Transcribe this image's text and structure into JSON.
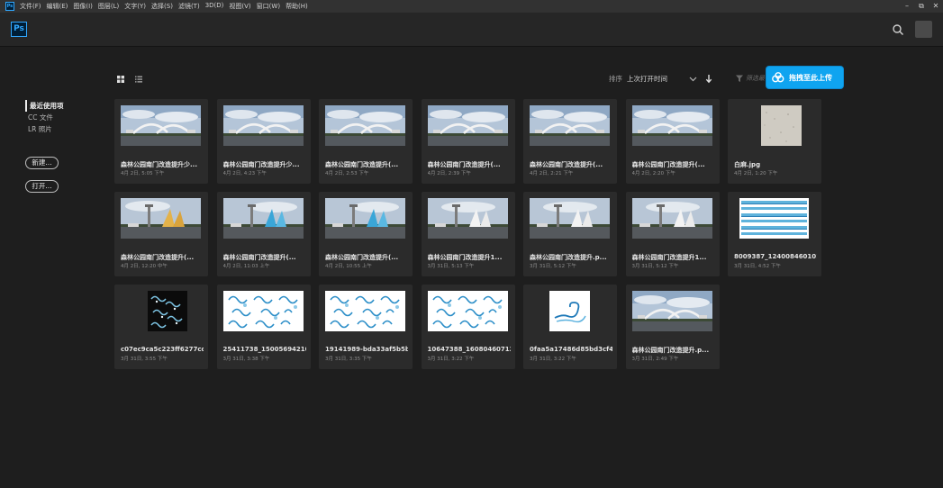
{
  "menubar": {
    "app_icon_text": "Ps",
    "items": [
      "文件(F)",
      "编辑(E)",
      "图像(I)",
      "图层(L)",
      "文字(Y)",
      "选择(S)",
      "滤镜(T)",
      "3D(D)",
      "视图(V)",
      "窗口(W)",
      "帮助(H)"
    ],
    "window_controls": [
      "–",
      "⧉",
      "✕"
    ]
  },
  "appbar": {
    "logo_text": "Ps",
    "search_icon": "search-icon"
  },
  "sidebar": {
    "nav": [
      "最近使用项",
      "CC 文件",
      "LR 照片"
    ],
    "new_label": "新建...",
    "open_label": "打开..."
  },
  "toolbar": {
    "sort_label": "排序",
    "sort_value": "上次打开时间",
    "filter_placeholder": "筛选最",
    "upload_label": "拖拽至此上传"
  },
  "colors": {
    "accent": "#31a8ff",
    "upload_badge": "#0fa4f0",
    "card_bg": "#2b2b2b",
    "page_bg": "#1e1e1e"
  },
  "recent_files": [
    {
      "name": "森林公园南门改造提升少...",
      "date": "4月 2日, 5:05 下午",
      "thumb": "bridge"
    },
    {
      "name": "森林公园南门改造提升少...",
      "date": "4月 2日, 4:23 下午",
      "thumb": "bridge"
    },
    {
      "name": "森林公园南门改造提升(...",
      "date": "4月 2日, 2:53 下午",
      "thumb": "bridge"
    },
    {
      "name": "森林公园南门改造提升(...",
      "date": "4月 2日, 2:39 下午",
      "thumb": "bridge"
    },
    {
      "name": "森林公园南门改造提升(...",
      "date": "4月 2日, 2:21 下午",
      "thumb": "bridge"
    },
    {
      "name": "森林公园南门改造提升(...",
      "date": "4月 2日, 2:20 下午",
      "thumb": "bridge"
    },
    {
      "name": "白麻.jpg",
      "date": "4月 2日, 1:20 下午",
      "thumb": "granite"
    },
    {
      "name": "森林公园南门改造提升(...",
      "date": "4月 2日, 12:20 中午",
      "thumb": "tower_gold"
    },
    {
      "name": "森林公园南门改造提升(...",
      "date": "4月 2日, 11:03 上午",
      "thumb": "tower_blue"
    },
    {
      "name": "森林公园南门改造提升(...",
      "date": "4月 2日, 10:55 上午",
      "thumb": "tower_blue"
    },
    {
      "name": "森林公园南门改造提升1...",
      "date": "3月 31日, 5:13 下午",
      "thumb": "tower_white"
    },
    {
      "name": "森林公园南门改造提升.p...",
      "date": "3月 31日, 5:12 下午",
      "thumb": "tower_white"
    },
    {
      "name": "森林公园南门改造提升1...",
      "date": "3月 31日, 5:12 下午",
      "thumb": "tower_white"
    },
    {
      "name": "8009387_124008460101_2...",
      "date": "3月 31日, 4:52 下午",
      "thumb": "wave_strips"
    },
    {
      "name": "c07ec9ca5c223ff6277cd0c...",
      "date": "3月 31日, 3:55 下午",
      "thumb": "wave_dark"
    },
    {
      "name": "25411738_150056942105_2...",
      "date": "3月 31日, 3:38 下午",
      "thumb": "wave_sheet"
    },
    {
      "name": "19141989-bda33af5b5b076...",
      "date": "3月 31日, 3:35 下午",
      "thumb": "wave_sheet"
    },
    {
      "name": "10647388_160804607127_...",
      "date": "3月 31日, 3:22 下午",
      "thumb": "wave_sheet"
    },
    {
      "name": "0faa5a17486d85bd3cf4c7b...",
      "date": "3月 31日, 3:22 下午",
      "thumb": "wave_single"
    },
    {
      "name": "森林公园南门改造提升.p...",
      "date": "3月 31日, 2:49 下午",
      "thumb": "bridge"
    }
  ]
}
